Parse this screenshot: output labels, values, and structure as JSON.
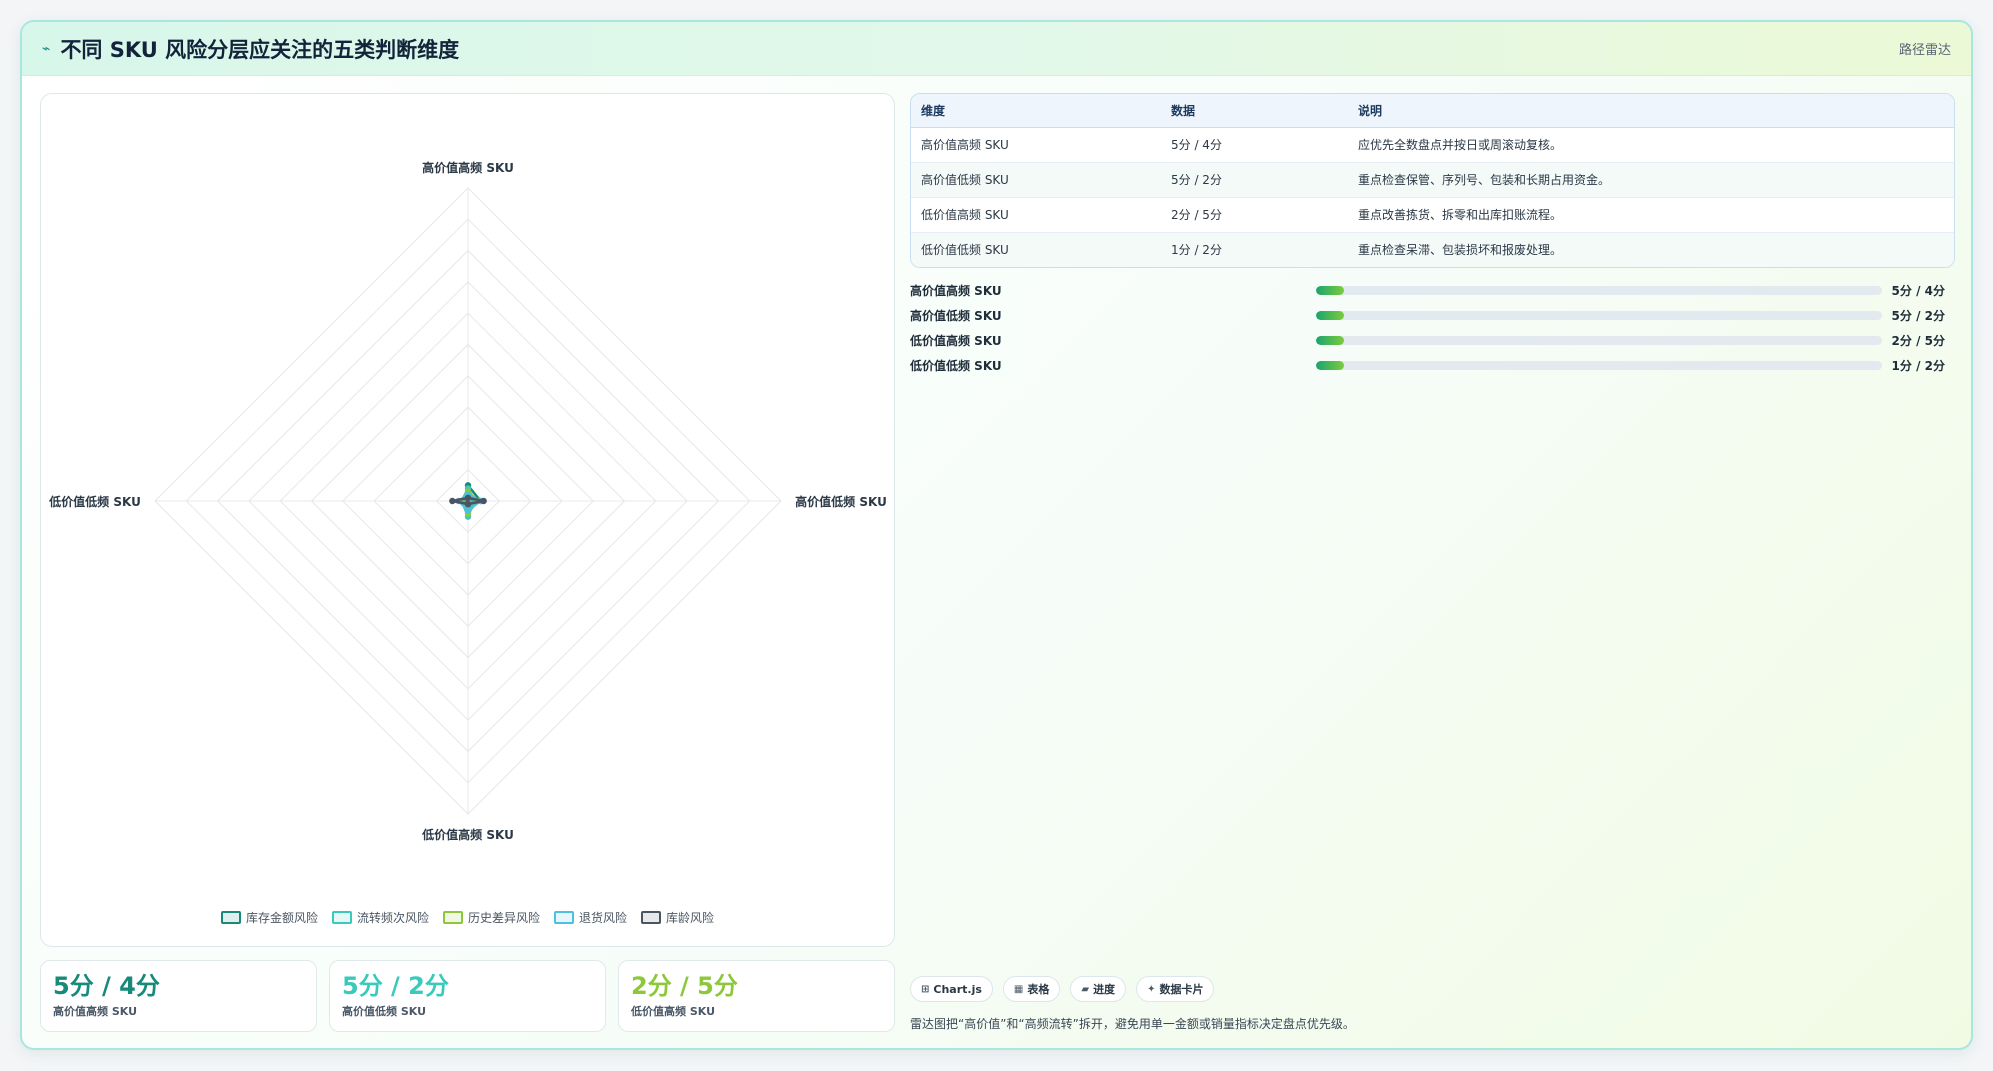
{
  "header": {
    "icon": "chart-line-icon",
    "title": "不同 SKU 风险分层应关注的五类判断维度",
    "tag": "路径雷达"
  },
  "chart_data": {
    "type": "radar",
    "axes": [
      "高价值高频 SKU",
      "高价值低频 SKU",
      "低价值高频 SKU",
      "低价值低频 SKU"
    ],
    "range": [
      0,
      100
    ],
    "grid_levels": 10,
    "legend_position": "bottom",
    "series": [
      {
        "name": "库存金额风险",
        "color": "#178a7a",
        "values": [
          5,
          4,
          2,
          1
        ]
      },
      {
        "name": "流转频次风险",
        "color": "#3ac9bd",
        "values": [
          4,
          2,
          5,
          2
        ]
      },
      {
        "name": "历史差异风险",
        "color": "#8cc83a",
        "values": [
          3,
          3,
          4,
          2
        ]
      },
      {
        "name": "退货风险",
        "color": "#4dbfe0",
        "values": [
          2,
          4,
          3,
          3
        ]
      },
      {
        "name": "库龄风险",
        "color": "#4a5462",
        "values": [
          1,
          5,
          1,
          5
        ]
      }
    ]
  },
  "stats": [
    {
      "value": "5分 / 4分",
      "label": "高价值高频 SKU",
      "color": "#178a7a"
    },
    {
      "value": "5分 / 2分",
      "label": "高价值低频 SKU",
      "color": "#3ac9bd"
    },
    {
      "value": "2分 / 5分",
      "label": "低价值高频 SKU",
      "color": "#8cc83a"
    }
  ],
  "table": {
    "headers": [
      "维度",
      "数据",
      "说明"
    ],
    "rows": [
      [
        "高价值高频 SKU",
        "5分 / 4分",
        "应优先全数盘点并按日或周滚动复核。"
      ],
      [
        "高价值低频 SKU",
        "5分 / 2分",
        "重点检查保管、序列号、包装和长期占用资金。"
      ],
      [
        "低价值高频 SKU",
        "2分 / 5分",
        "重点改善拣货、拆零和出库扣账流程。"
      ],
      [
        "低价值低频 SKU",
        "1分 / 2分",
        "重点检查呆滞、包装损坏和报废处理。"
      ]
    ]
  },
  "progress": [
    {
      "label": "高价值高频 SKU",
      "value": "5分 / 4分",
      "fraction": 0.05
    },
    {
      "label": "高价值低频 SKU",
      "value": "5分 / 2分",
      "fraction": 0.05
    },
    {
      "label": "低价值高频 SKU",
      "value": "2分 / 5分",
      "fraction": 0.05
    },
    {
      "label": "低价值低频 SKU",
      "value": "1分 / 2分",
      "fraction": 0.05
    }
  ],
  "chips": [
    {
      "icon": "chart-icon",
      "glyph": "⊞",
      "label": "Chart.js"
    },
    {
      "icon": "table-icon",
      "glyph": "▦",
      "label": "表格"
    },
    {
      "icon": "progress-icon",
      "glyph": "▰",
      "label": "进度"
    },
    {
      "icon": "sparkle-icon",
      "glyph": "✦",
      "label": "数据卡片"
    }
  ],
  "note": "雷达图把“高价值”和“高频流转”拆开，避免用单一金额或销量指标决定盘点优先级。"
}
